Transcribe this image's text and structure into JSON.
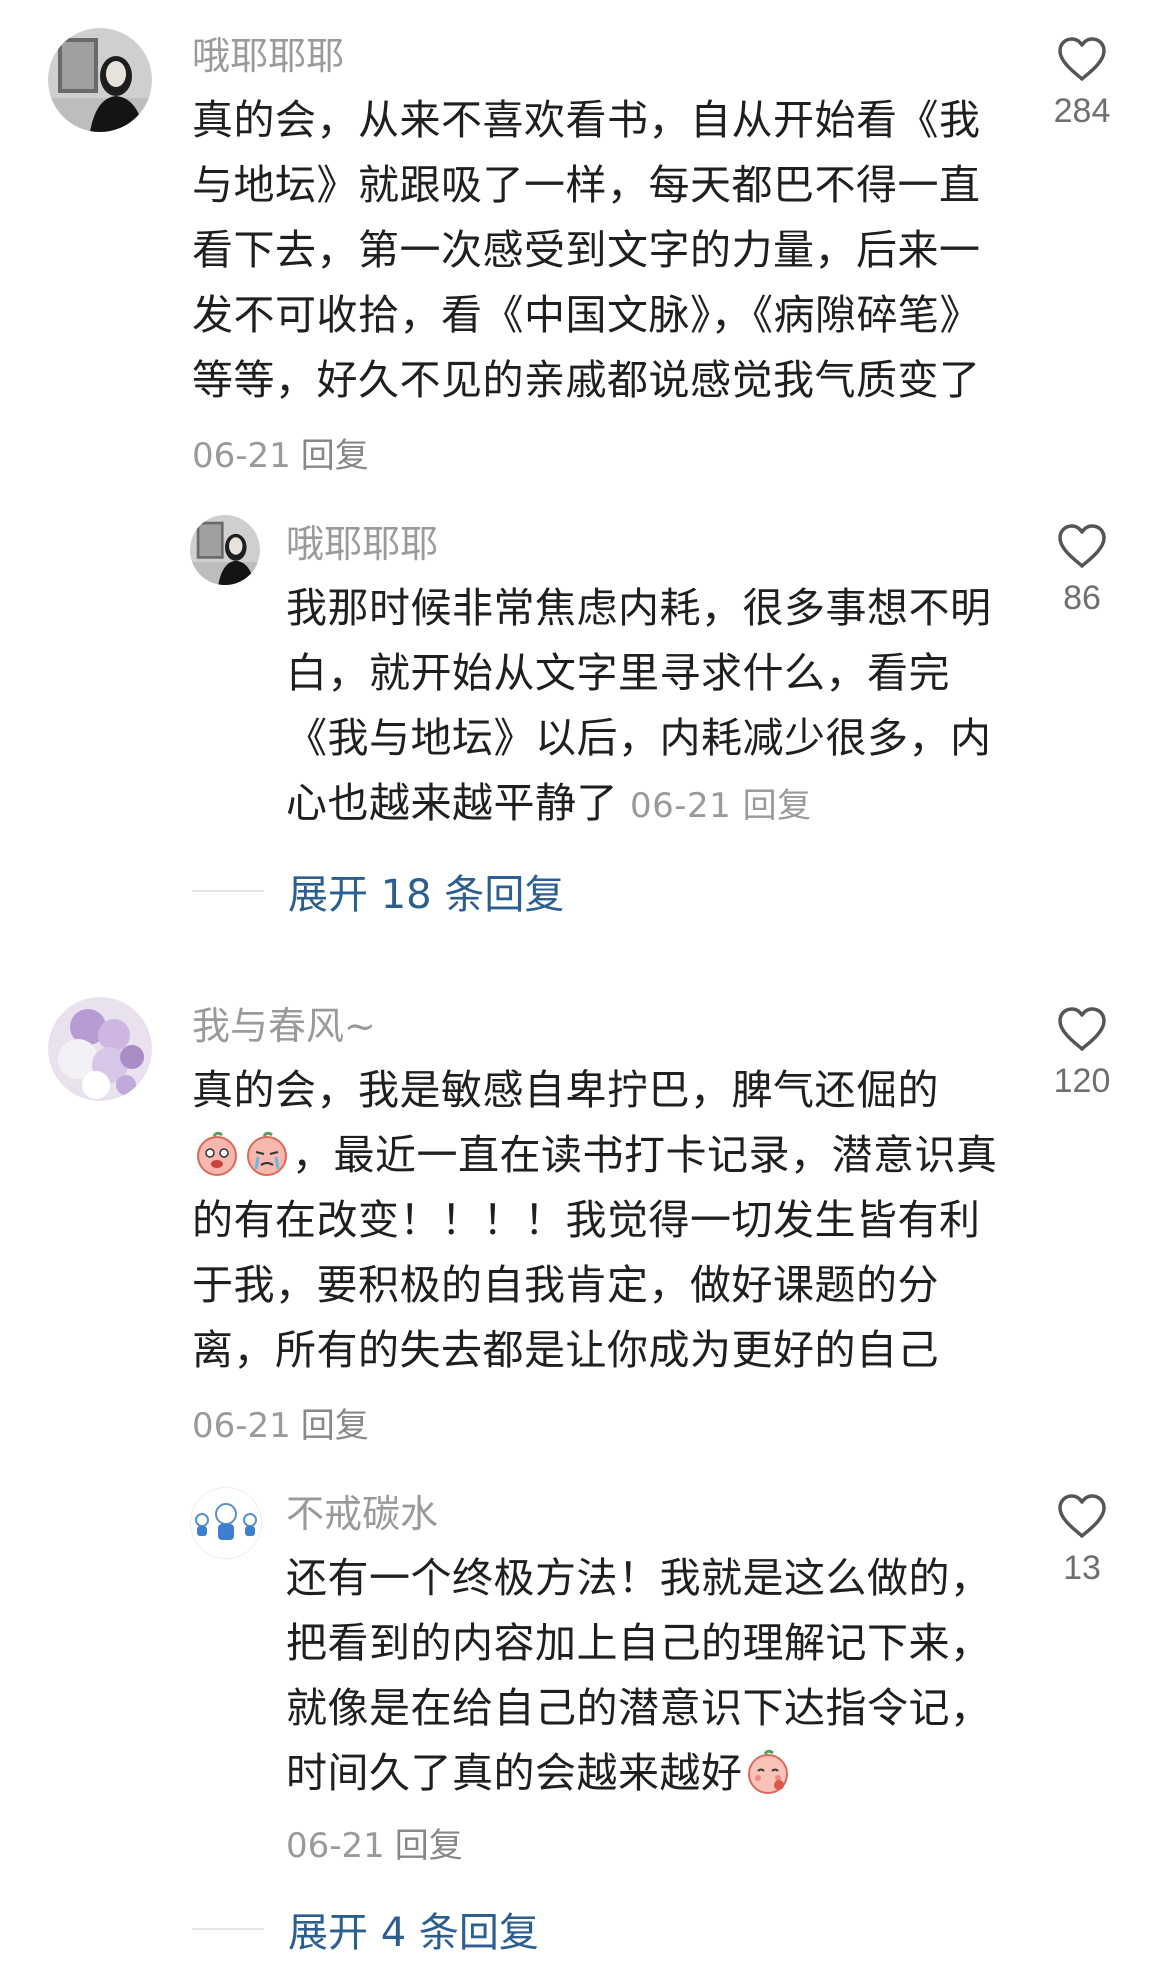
{
  "comments": [
    {
      "user": "哦耶耶耶",
      "text": "真的会，从来不喜欢看书，自从开始看《我与地坛》就跟吸了一样，每天都巴不得一直看下去，第一次感受到文字的力量，后来一发不可收拾，看《中国文脉》，《病隙碎笔》等等，好久不见的亲戚都说感觉我气质变了",
      "date": "06-21",
      "reply_label": "回复",
      "likes": "284",
      "avatar": "portrait-photo-avatar",
      "reply": {
        "user": "哦耶耶耶",
        "text": "我那时候非常焦虑内耗，很多事想不明白，就开始从文字里寻求什么，看完《我与地坛》以后，内耗减少很多，内心也越来越平静了",
        "date": "06-21",
        "reply_label": "回复",
        "likes": "86"
      },
      "expand_label": "展开 18 条回复"
    },
    {
      "user": "我与春风~",
      "text_before_emoji": "真的会，我是敏感自卑拧巴，脾气还倔的",
      "emojis": [
        "crying-peach-emoji",
        "sobbing-peach-emoji"
      ],
      "text_after_emoji": "，最近一直在读书打卡记录，潜意识真的有在改变！！！！我觉得一切发生皆有利于我，要积极的自我肯定，做好课题的分离，所有的失去都是让你成为更好的自己",
      "date": "06-21",
      "reply_label": "回复",
      "likes": "120",
      "avatar": "flower-bouquet-avatar",
      "reply": {
        "user": "不戒碳水",
        "text": "还有一个终极方法！我就是这么做的，把看到的内容加上自己的理解记下来，就像是在给自己的潜意识下达指令记，时间久了真的会越来越好",
        "emoji": "shy-peach-emoji",
        "date": "06-21",
        "reply_label": "回复",
        "likes": "13"
      },
      "expand_label": "展开 4 条回复"
    }
  ],
  "colors": {
    "username": "#9a9a9a",
    "body_text": "#1f1f1f",
    "expand_link": "#2c5e8f",
    "heart_outline": "#555555"
  }
}
